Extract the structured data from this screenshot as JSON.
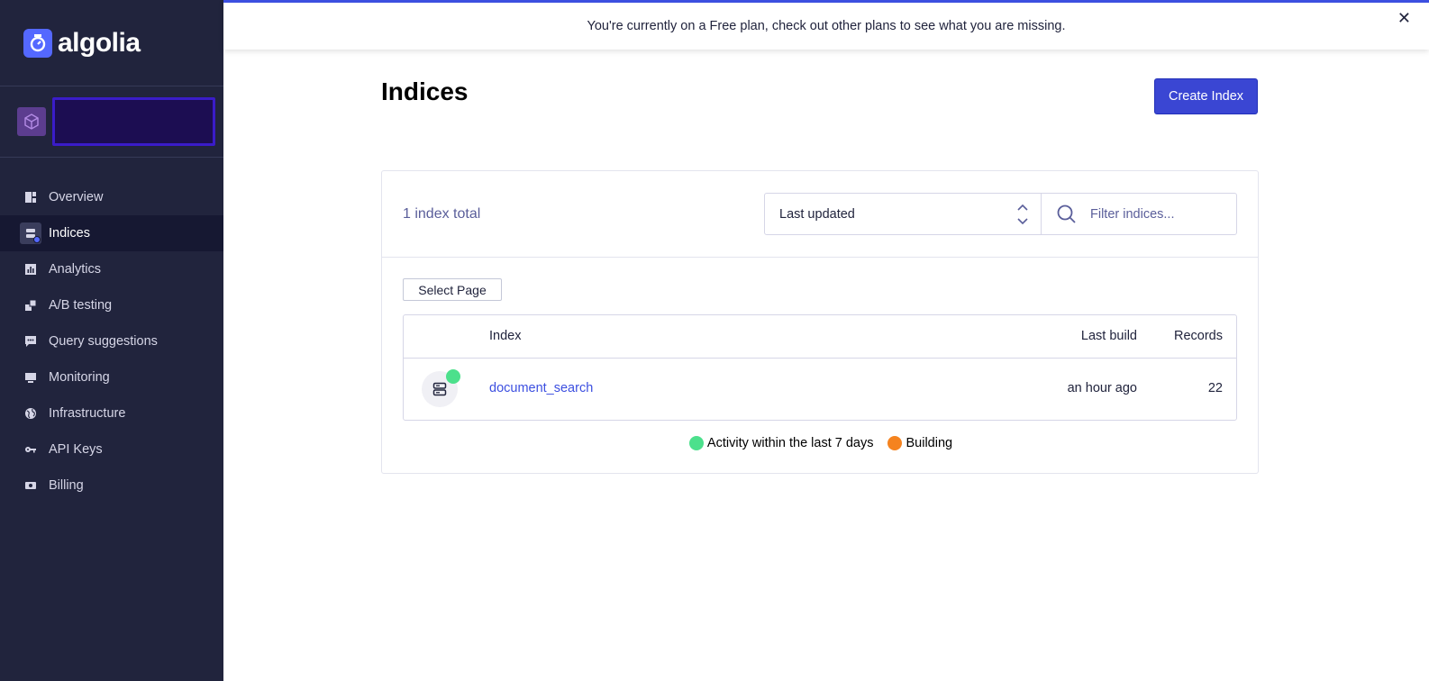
{
  "brand": {
    "name": "algolia"
  },
  "sidebar": {
    "items": [
      {
        "label": "Overview",
        "icon": "overview-icon"
      },
      {
        "label": "Indices",
        "icon": "indices-icon",
        "active": true
      },
      {
        "label": "Analytics",
        "icon": "analytics-icon"
      },
      {
        "label": "A/B testing",
        "icon": "ab-testing-icon"
      },
      {
        "label": "Query suggestions",
        "icon": "query-suggestions-icon"
      },
      {
        "label": "Monitoring",
        "icon": "monitoring-icon"
      },
      {
        "label": "Infrastructure",
        "icon": "globe-icon"
      },
      {
        "label": "API Keys",
        "icon": "key-icon"
      },
      {
        "label": "Billing",
        "icon": "billing-icon"
      }
    ]
  },
  "banner": {
    "message": "You're currently on a Free plan, check out other plans to see what you are missing.",
    "close": "✕"
  },
  "main": {
    "title": "Indices",
    "create_button": "Create Index",
    "total": "1 index total",
    "sort_selected": "Last updated",
    "filter_placeholder": "Filter indices...",
    "select_page": "Select Page",
    "table": {
      "headers": {
        "index": "Index",
        "last_build": "Last build",
        "records": "Records"
      },
      "rows": [
        {
          "name": "document_search",
          "last_build": "an hour ago",
          "records": "22",
          "status": "active"
        }
      ]
    },
    "legend": [
      {
        "label": "Activity within the last 7 days",
        "color": "#4ce08c"
      },
      {
        "label": "Building",
        "color": "#f5831f"
      }
    ]
  },
  "colors": {
    "sidebar_bg": "#21243d",
    "accent": "#3a46d3",
    "link": "#3c4fe0",
    "active_green": "#4ce08c",
    "building_orange": "#f5831f"
  }
}
